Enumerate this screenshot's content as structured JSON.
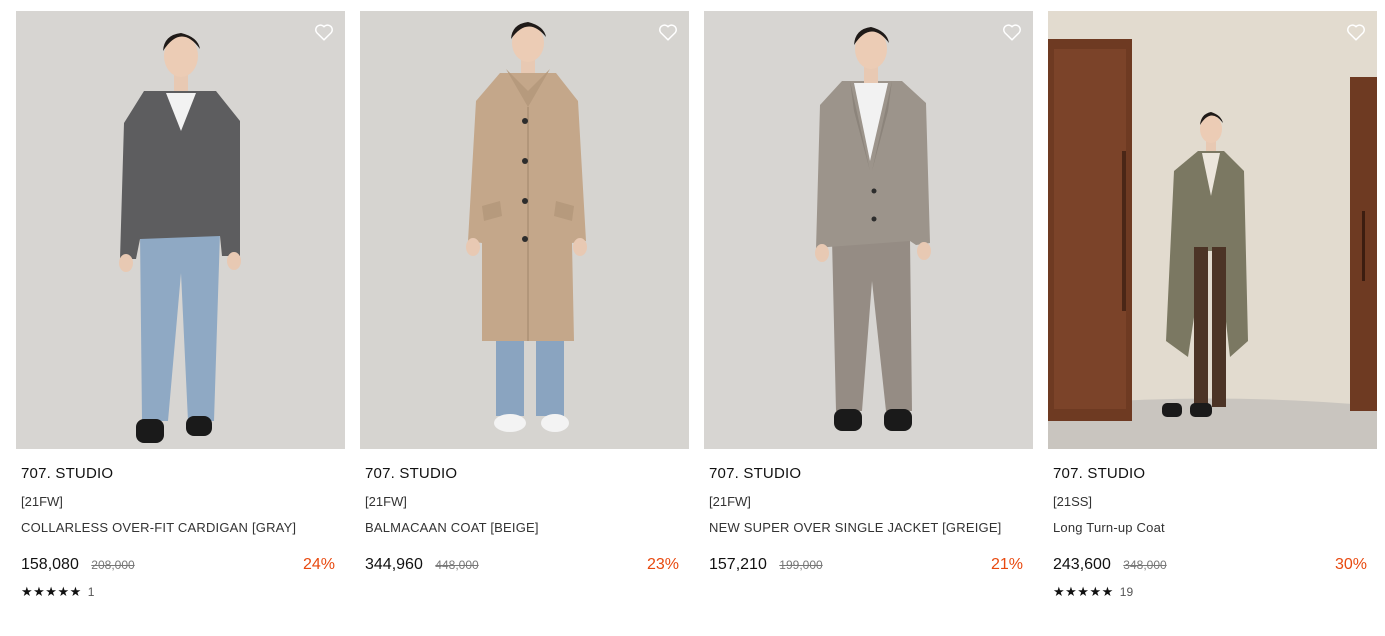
{
  "products": [
    {
      "brand": "707. STUDIO",
      "season": "[21FW]",
      "name": "COLLARLESS OVER-FIT CARDIGAN [GRAY]",
      "price": "158,080",
      "original_price": "208,000",
      "discount": "24%",
      "stars": "★★★★★",
      "review_count": "1",
      "image": "model in gray cardigan and light jeans",
      "wishlist_icon": "heart-outline-icon"
    },
    {
      "brand": "707. STUDIO",
      "season": "[21FW]",
      "name": "BALMACAAN COAT [BEIGE]",
      "price": "344,960",
      "original_price": "448,000",
      "discount": "23%",
      "stars": "",
      "review_count": "",
      "image": "model in long beige coat",
      "wishlist_icon": "heart-outline-icon"
    },
    {
      "brand": "707. STUDIO",
      "season": "[21FW]",
      "name": "NEW SUPER OVER SINGLE JACKET [GREIGE]",
      "price": "157,210",
      "original_price": "199,000",
      "discount": "21%",
      "stars": "",
      "review_count": "",
      "image": "model in greige suit jacket and trousers",
      "wishlist_icon": "heart-outline-icon"
    },
    {
      "brand": "707. STUDIO",
      "season": "[21SS]",
      "name": "Long Turn-up Coat",
      "price": "243,600",
      "original_price": "348,000",
      "discount": "30%",
      "stars": "★★★★★",
      "review_count": "19",
      "image": "model in long check coat in a room with wooden doors",
      "wishlist_icon": "heart-outline-icon"
    }
  ],
  "colors": {
    "discount": "#e8490f",
    "studio_bg": "#d6d4d1",
    "room_bg": "#e4ddd0"
  }
}
